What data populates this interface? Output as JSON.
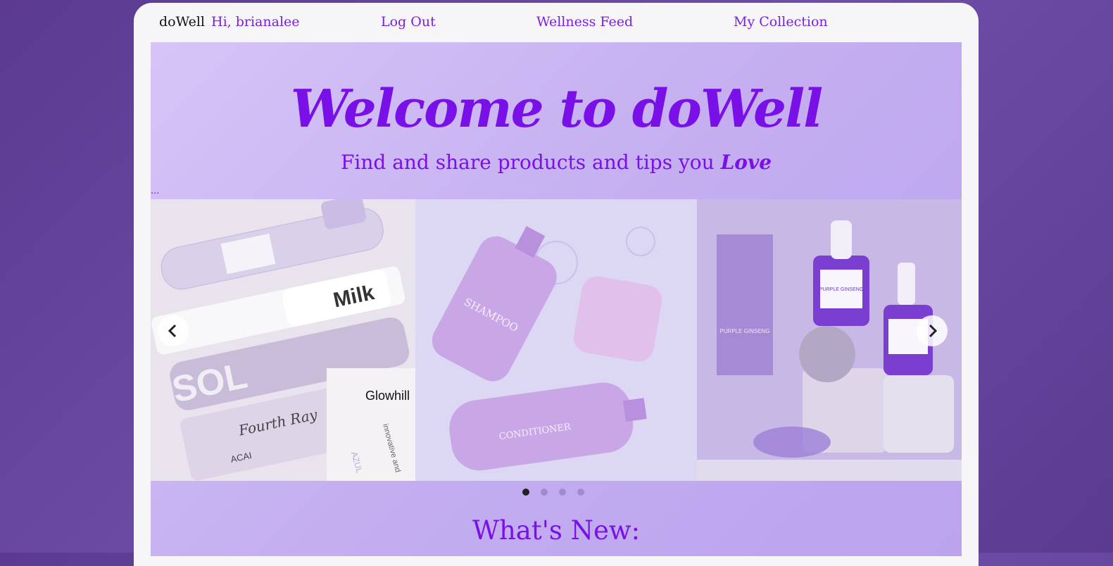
{
  "nav": {
    "brand": "doWell",
    "greeting": "Hi, brianalee",
    "logout": "Log Out",
    "feed": "Wellness Feed",
    "collection": "My Collection"
  },
  "hero": {
    "title": "Welcome to doWell",
    "subtitle": "Find and share products and tips you",
    "subtitle_emphasis": "Love",
    "ellipsis": "..."
  },
  "carousel": {
    "slides": [
      {
        "texts": [
          "SOL",
          "Milk",
          "Glowhill",
          "Fourth Ray",
          "ACAI",
          "innovative and",
          "AZUL"
        ]
      },
      {
        "texts": [
          "SHAMPOO",
          "CONDITIONER"
        ]
      },
      {
        "texts": [
          "PURPLE GINSENG",
          "PURPLE GINSENG"
        ]
      }
    ],
    "prev_icon": "chevron-left-icon",
    "next_icon": "chevron-right-icon",
    "indicator_count": 4,
    "active_index": 0
  },
  "section": {
    "whats_new": "What's New:"
  },
  "colors": {
    "accent": "#7a10e8",
    "link": "#7a1fe0"
  }
}
